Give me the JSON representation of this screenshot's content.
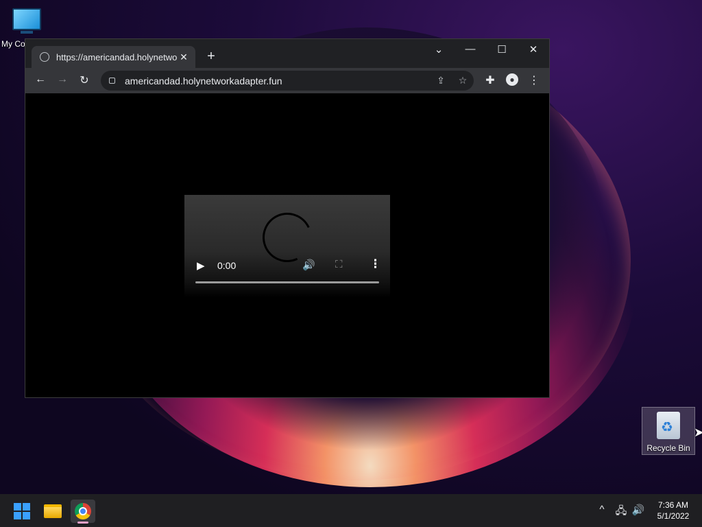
{
  "desktop": {
    "icons": [
      {
        "label": "My Co",
        "icon": "computer-icon"
      },
      {
        "label": "Recycle Bin",
        "icon": "recycle-bin-icon"
      }
    ]
  },
  "browser": {
    "tab": {
      "title": "https://americandad.holynetwork",
      "close": "✕"
    },
    "new_tab": "+",
    "window_controls": {
      "tab_search": "⌄",
      "minimize": "—",
      "maximize": "☐",
      "close": "✕"
    },
    "toolbar": {
      "back": "←",
      "forward": "→",
      "reload": "↻",
      "extensions": "✚",
      "menu": "⋮"
    },
    "address": {
      "url": "americandad.holynetworkadapter.fun",
      "share": "⇪",
      "bookmark": "☆"
    },
    "video": {
      "time": "0:00",
      "play": "▶",
      "mute": "🔊",
      "fullscreen": "⛶",
      "menu": "⋮"
    }
  },
  "taskbar": {
    "apps": [
      "start-icon",
      "file-explorer-icon",
      "chrome-icon"
    ],
    "tray": {
      "chevron": "^",
      "network": "🖧",
      "volume": "🔊"
    },
    "clock": {
      "time": "7:36 AM",
      "date": "5/1/2022"
    }
  },
  "colors": {
    "accent": "#3aa0ff",
    "tab_bg": "#35363a",
    "titlebar_bg": "#202124"
  }
}
